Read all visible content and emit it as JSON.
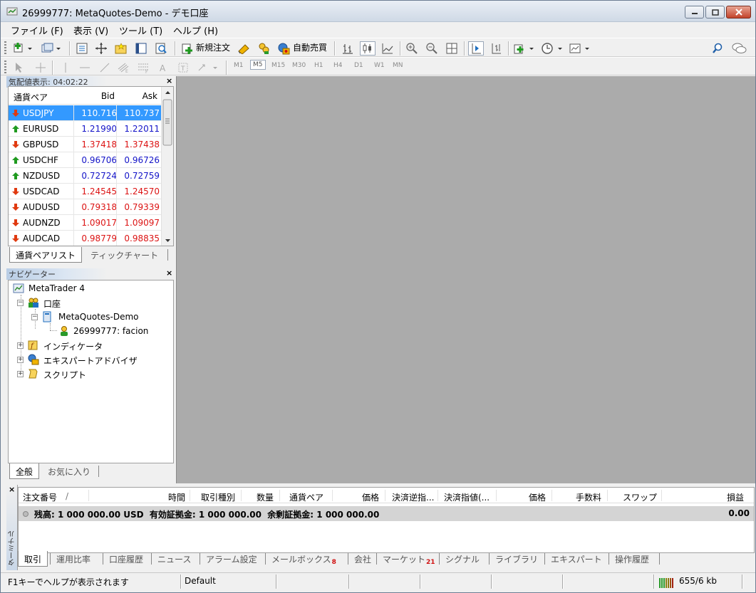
{
  "window": {
    "title": "26999777: MetaQuotes-Demo - デモ口座"
  },
  "menu": [
    "ファイル (F)",
    "表示 (V)",
    "ツール (T)",
    "ヘルプ (H)"
  ],
  "toolbar": {
    "new_order": "新規注文",
    "auto_trading": "自動売買"
  },
  "timeframes": [
    "M1",
    "M5",
    "M15",
    "M30",
    "H1",
    "H4",
    "D1",
    "W1",
    "MN"
  ],
  "active_timeframe": "M5",
  "market_watch": {
    "title": "気配値表示: 04:02:22",
    "col_symbol": "通貨ペア",
    "col_bid": "Bid",
    "col_ask": "Ask",
    "rows": [
      {
        "symbol": "USDJPY",
        "bid": "110.716",
        "ask": "110.737",
        "dir": "down"
      },
      {
        "symbol": "EURUSD",
        "bid": "1.21990",
        "ask": "1.22011",
        "dir": "up"
      },
      {
        "symbol": "GBPUSD",
        "bid": "1.37418",
        "ask": "1.37438",
        "dir": "down"
      },
      {
        "symbol": "USDCHF",
        "bid": "0.96706",
        "ask": "0.96726",
        "dir": "up"
      },
      {
        "symbol": "NZDUSD",
        "bid": "0.72724",
        "ask": "0.72759",
        "dir": "up"
      },
      {
        "symbol": "USDCAD",
        "bid": "1.24545",
        "ask": "1.24570",
        "dir": "down"
      },
      {
        "symbol": "AUDUSD",
        "bid": "0.79318",
        "ask": "0.79339",
        "dir": "down"
      },
      {
        "symbol": "AUDNZD",
        "bid": "1.09017",
        "ask": "1.09097",
        "dir": "down"
      },
      {
        "symbol": "AUDCAD",
        "bid": "0.98779",
        "ask": "0.98835",
        "dir": "down"
      }
    ],
    "tabs": [
      "通貨ペアリスト",
      "ティックチャート"
    ],
    "colors": {
      "up": "#1414c8",
      "down": "#dc1414",
      "selected": "#3399ff"
    }
  },
  "navigator": {
    "title": "ナビゲーター",
    "root": "MetaTrader 4",
    "accounts": "口座",
    "server": "MetaQuotes-Demo",
    "account": "26999777: facion",
    "indicators": "インディケータ",
    "experts": "エキスパートアドバイザ",
    "scripts": "スクリプト",
    "tabs": [
      "全般",
      "お気に入り"
    ]
  },
  "terminal": {
    "side_label": "ターミナル",
    "columns": [
      "注文番号",
      "/",
      "時間",
      "取引種別",
      "数量",
      "通貨ペア",
      "価格",
      "決済逆指...",
      "決済指値(...",
      "価格",
      "手数料",
      "スワップ",
      "損益"
    ],
    "balance_line": "残高: 1 000 000.00 USD  有効証拠金: 1 000 000.00  余剰証拠金: 1 000 000.00",
    "balance_pl": "0.00",
    "tabs": [
      {
        "label": "取引",
        "badge": ""
      },
      {
        "label": "運用比率",
        "badge": ""
      },
      {
        "label": "口座履歴",
        "badge": ""
      },
      {
        "label": "ニュース",
        "badge": ""
      },
      {
        "label": "アラーム設定",
        "badge": ""
      },
      {
        "label": "メールボックス",
        "badge": "8"
      },
      {
        "label": "会社",
        "badge": ""
      },
      {
        "label": "マーケット",
        "badge": "21"
      },
      {
        "label": "シグナル",
        "badge": ""
      },
      {
        "label": "ライブラリ",
        "badge": ""
      },
      {
        "label": "エキスパート",
        "badge": ""
      },
      {
        "label": "操作履歴",
        "badge": ""
      }
    ]
  },
  "status": {
    "help": "F1キーでヘルプが表示されます",
    "profile": "Default",
    "traffic": "655/6 kb"
  }
}
